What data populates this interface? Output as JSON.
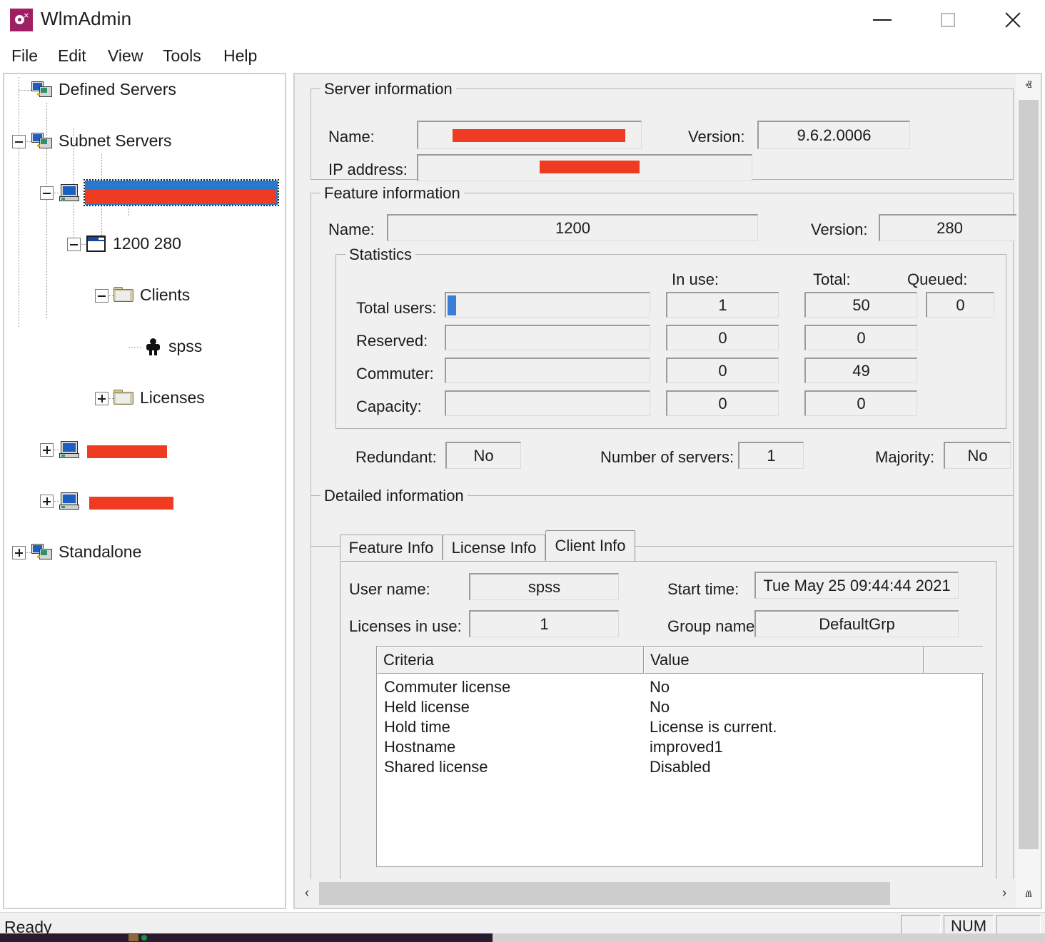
{
  "window": {
    "title": "WlmAdmin",
    "icon": "app-icon",
    "minimize_label": "—",
    "maximize_label": "□",
    "close_label": "✕"
  },
  "menu": {
    "items": [
      {
        "label": "File"
      },
      {
        "label": "Edit"
      },
      {
        "label": "View"
      },
      {
        "label": "Tools"
      },
      {
        "label": "Help"
      }
    ]
  },
  "tree": {
    "nodes": [
      {
        "label": "Defined Servers",
        "icon": "servers-icon",
        "expander": "none",
        "redacted": false
      },
      {
        "label": "Subnet Servers",
        "icon": "servers-icon",
        "expander": "minus",
        "redacted": false
      },
      {
        "label": "",
        "icon": "pc-icon",
        "expander": "minus",
        "selected": true,
        "redacted": true
      },
      {
        "label": "1200 280",
        "icon": "window-icon",
        "expander": "minus",
        "redacted": false
      },
      {
        "label": "Clients",
        "icon": "folder-icon",
        "expander": "minus",
        "redacted": false
      },
      {
        "label": "spss",
        "icon": "person-icon",
        "expander": "none",
        "redacted": false
      },
      {
        "label": "Licenses",
        "icon": "folder-icon",
        "expander": "plus",
        "redacted": false
      },
      {
        "label": "",
        "icon": "pc-icon",
        "expander": "plus",
        "redacted": true
      },
      {
        "label": "",
        "icon": "pc-icon",
        "expander": "plus",
        "redacted": true
      },
      {
        "label": "Standalone",
        "icon": "servers-icon",
        "expander": "plus",
        "redacted": false
      }
    ]
  },
  "server_information": {
    "legend": "Server information",
    "name_label": "Name:",
    "name_value": "",
    "version_label": "Version:",
    "version_value": "9.6.2.0006",
    "ip_label": "IP address:",
    "ip_value": ""
  },
  "feature_information": {
    "legend": "Feature information",
    "name_label": "Name:",
    "name_value": "1200",
    "version_label": "Version:",
    "version_value": "280"
  },
  "statistics": {
    "legend": "Statistics",
    "col_inuse": "In use:",
    "col_total": "Total:",
    "col_queued": "Queued:",
    "rows": [
      {
        "label": "Total users:",
        "bar_percent": 4,
        "in_use": "1",
        "total": "50",
        "queued": "0"
      },
      {
        "label": "Reserved:",
        "bar_percent": 0,
        "in_use": "0",
        "total": "0",
        "queued": ""
      },
      {
        "label": "Commuter:",
        "bar_percent": 0,
        "in_use": "0",
        "total": "49",
        "queued": ""
      },
      {
        "label": "Capacity:",
        "bar_percent": 0,
        "in_use": "0",
        "total": "0",
        "queued": ""
      }
    ],
    "redundant_label": "Redundant:",
    "redundant_value": "No",
    "servers_label": "Number of servers:",
    "servers_value": "1",
    "majority_label": "Majority:",
    "majority_value": "No"
  },
  "detailed_information": {
    "legend": "Detailed information",
    "tabs": [
      {
        "label": "Feature Info",
        "active": false
      },
      {
        "label": "License Info",
        "active": false
      },
      {
        "label": "Client Info",
        "active": true
      }
    ],
    "client_info": {
      "user_name_label": "User name:",
      "user_name_value": "spss",
      "start_time_label": "Start time:",
      "start_time_value": "Tue May 25 09:44:44 2021",
      "licenses_label": "Licenses in use:",
      "licenses_value": "1",
      "group_label": "Group name:",
      "group_value": "DefaultGrp",
      "table": {
        "headers": [
          "Criteria",
          "Value",
          ""
        ],
        "rows": [
          {
            "criteria": "Commuter license",
            "value": "No"
          },
          {
            "criteria": "Held license",
            "value": "No"
          },
          {
            "criteria": "Hold time",
            "value": "License is current."
          },
          {
            "criteria": "Hostname",
            "value": "improved1"
          },
          {
            "criteria": "Shared license",
            "value": "Disabled"
          }
        ]
      }
    }
  },
  "scrollbars": {
    "vertical_up": "ⱏ",
    "vertical_down": "ⱞ",
    "horizontal_left": "‹",
    "horizontal_right": "›"
  },
  "statusbar": {
    "message": "Ready",
    "panel_num": "NUM"
  },
  "colors": {
    "selection_blue": "#2878d0",
    "redaction_red": "#ef3b21",
    "progress_blue": "#3a7fd5",
    "app_icon_purple": "#9c2063",
    "window_bg": "#f0f0f0"
  }
}
